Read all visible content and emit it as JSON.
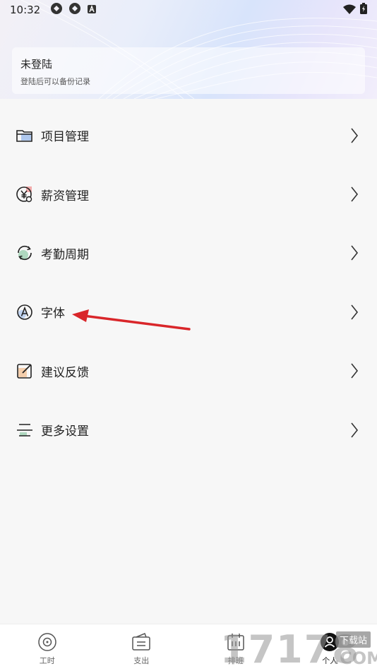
{
  "status_bar": {
    "time": "10:32",
    "icons": [
      "sync-icon",
      "sync-icon",
      "a-app-icon"
    ],
    "right_icons": [
      "wifi-icon",
      "battery-icon"
    ]
  },
  "login": {
    "title": "未登陆",
    "subtitle": "登陆后可以备份记录"
  },
  "menu": {
    "items": [
      {
        "label": "项目管理",
        "icon": "folder-icon"
      },
      {
        "label": "薪资管理",
        "icon": "yen-icon"
      },
      {
        "label": "考勤周期",
        "icon": "cycle-icon"
      },
      {
        "label": "字体",
        "icon": "font-icon"
      },
      {
        "label": "建议反馈",
        "icon": "edit-icon"
      },
      {
        "label": "更多设置",
        "icon": "settings-list-icon"
      }
    ]
  },
  "tabs": [
    {
      "label": "工时",
      "icon": "clock-icon"
    },
    {
      "label": "支出",
      "icon": "wallet-icon"
    },
    {
      "label": "排班",
      "icon": "calendar-icon"
    },
    {
      "label": "个人",
      "icon": "user-icon"
    }
  ],
  "watermark": {
    "text": "17178",
    "sub": "下载站",
    "domain": ".COM"
  },
  "colors": {
    "accent_red": "#d9262a",
    "icon_stroke": "#222222",
    "icon_accent_blue": "#7fa8e8",
    "icon_accent_green": "#9ccfb0",
    "icon_accent_red": "#f08a8a",
    "icon_accent_orange": "#f2b27a"
  }
}
